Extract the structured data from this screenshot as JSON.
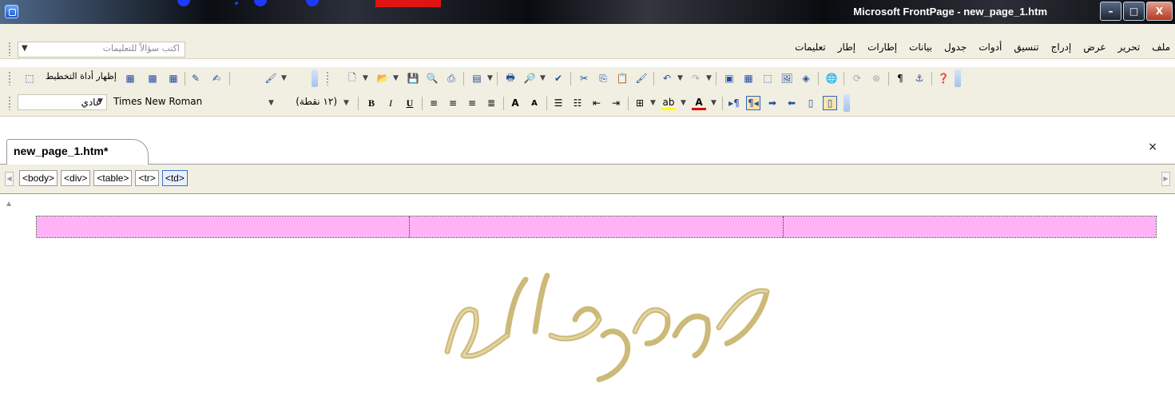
{
  "window": {
    "title": "Microsoft FrontPage - new_page_1.htm",
    "minimize_glyph": "–",
    "maximize_glyph": "□",
    "close_glyph": "X"
  },
  "menu": {
    "items": [
      "ملف",
      "تحرير",
      "عرض",
      "إدراج",
      "تنسيق",
      "أدوات",
      "جدول",
      "بيانات",
      "إطارات",
      "إطار",
      "تعليمات"
    ]
  },
  "help_box": {
    "placeholder": "اكتب سؤالاً للتعليمات"
  },
  "toolbar1": {
    "show_layout_label": "إظهار أداة التخطيط"
  },
  "toolbar2": {
    "style_value": "عادي",
    "font_value": "Times New Roman",
    "size_value": "(١٢ نقطة)"
  },
  "tab": {
    "label": "new_page_1.htm*",
    "close_glyph": "×"
  },
  "tag_selector": {
    "tags": [
      "<body>",
      "<div>",
      "<table>",
      "<tr>",
      "<td>"
    ]
  },
  "editor": {
    "table_cells": 3,
    "cell_color": "#ffb3f6",
    "watermark_color": "#c8b26a"
  },
  "icons": {
    "new_doc": "new-document-icon",
    "open": "open-folder-icon",
    "save": "save-icon",
    "help": "help-icon"
  }
}
